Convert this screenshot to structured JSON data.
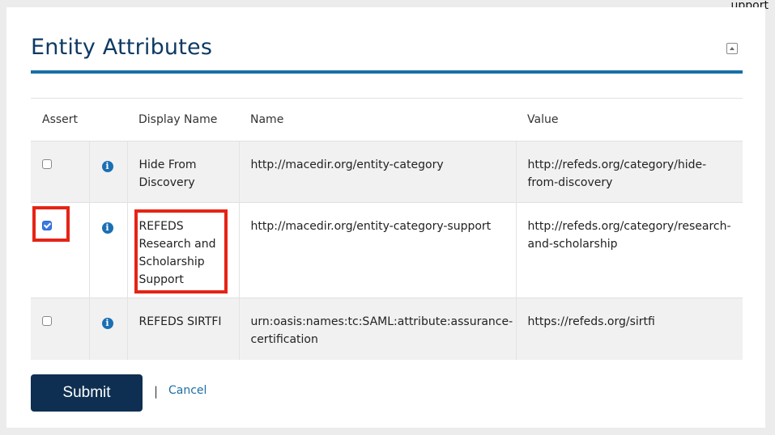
{
  "top_clip_text": "upport",
  "section": {
    "title": "Entity Attributes"
  },
  "table": {
    "headers": [
      "Assert",
      "",
      "Display Name",
      "Name",
      "Value"
    ],
    "rows": [
      {
        "checked": false,
        "display_name": "Hide From Discovery",
        "name": "http://macedir.org/entity-category",
        "value": "http://refeds.org/category/hide-from-discovery"
      },
      {
        "checked": true,
        "display_name": "REFEDS Research and Scholarship Support",
        "name": "http://macedir.org/entity-category-support",
        "value": "http://refeds.org/category/research-and-scholarship"
      },
      {
        "checked": false,
        "display_name": "REFEDS SIRTFI",
        "name": "urn:oasis:names:tc:SAML:attribute:assurance-certification",
        "value": "https://refeds.org/sirtfi"
      }
    ]
  },
  "actions": {
    "submit_label": "Submit",
    "separator": "|",
    "cancel_label": "Cancel"
  },
  "icons": {
    "info": "info-icon",
    "collapse": "collapse-icon"
  },
  "colors": {
    "title": "#0e3a63",
    "rule": "#1a6fa6",
    "submit_bg": "#0e2f51",
    "highlight": "#e52415",
    "info_icon": "#1b6fb3"
  }
}
